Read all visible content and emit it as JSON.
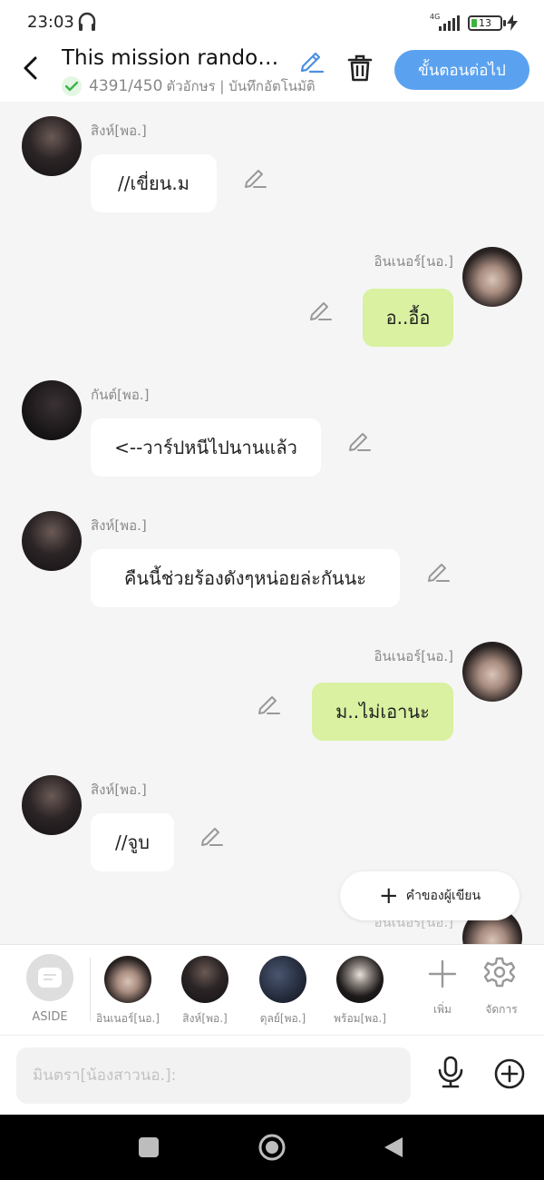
{
  "status_bar": {
    "time": "23:03",
    "network": "4G",
    "battery": "13",
    "icons": [
      "headphones-icon",
      "signal-icon",
      "battery-icon",
      "charging-bolt-icon"
    ]
  },
  "header": {
    "title": "This mission randomly...",
    "count": "4391/450",
    "meta": "ตัวอักษร | บันทึกอัตโนมัติ",
    "next_button": "ขั้นตอนต่อไป",
    "icons": [
      "back-arrow-icon",
      "edit-pencil-icon",
      "check-icon",
      "trash-icon"
    ],
    "accent_color": "#5aa2f0"
  },
  "messages": [
    {
      "side": "left",
      "sender": "สิงห์[พอ.]",
      "text": "//เขี่ยน.ม"
    },
    {
      "side": "right",
      "sender": "อินเนอร์[นอ.]",
      "text": "อ..อื้อ"
    },
    {
      "side": "left",
      "sender": "กันต์[พอ.]",
      "text": "<--วาร์ปหนีไปนานแล้ว"
    },
    {
      "side": "left",
      "sender": "สิงห์[พอ.]",
      "text": "คืนนี้ช่วยร้องดังๆหน่อยล่ะกันนะ"
    },
    {
      "side": "right",
      "sender": "อินเนอร์[นอ.]",
      "text": "ม..ไม่เอานะ"
    },
    {
      "side": "left",
      "sender": "สิงห์[พอ.]",
      "text": "//จูบ"
    },
    {
      "side": "right",
      "sender": "อินเนอร์[นอ.]",
      "text": ""
    }
  ],
  "bubble_colors": {
    "left": "#ffffff",
    "right": "#d9f1a0"
  },
  "author_note_button": "คำของผู้เขียน",
  "characters": {
    "aside_label": "ASIDE",
    "list": [
      {
        "name": "อินเนอร์[นอ.]"
      },
      {
        "name": "สิงห์[พอ.]"
      },
      {
        "name": "ดุลย์[พอ.]"
      },
      {
        "name": "พร้อม[พอ.]"
      }
    ],
    "add_label": "เพิ่ม",
    "manage_label": "จัดการ"
  },
  "input": {
    "placeholder": "มินตรา[น้องสาวนอ.]:",
    "icons": [
      "microphone-icon",
      "add-circle-icon"
    ]
  },
  "nav": {
    "icons": [
      "recent-apps-icon",
      "home-icon",
      "back-icon"
    ]
  }
}
